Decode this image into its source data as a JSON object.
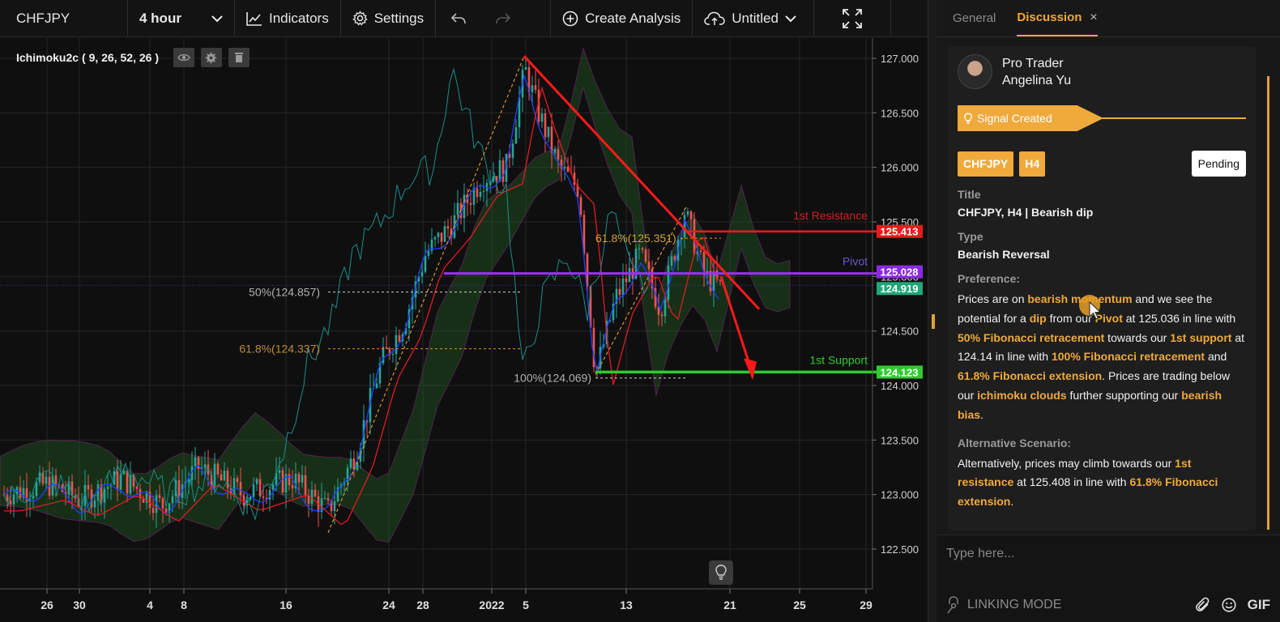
{
  "toolbar": {
    "symbol": "CHFJPY",
    "interval": "4 hour",
    "indicators_label": "Indicators",
    "settings_label": "Settings",
    "create_analysis_label": "Create Analysis",
    "layout_name": "Untitled"
  },
  "indicator": {
    "name": "Ichimoku2c",
    "params": "( 9, 26, 52, 26 )"
  },
  "chart_data": {
    "type": "candlestick",
    "symbol": "CHFJPY",
    "timeframe": "4 hour",
    "ylim": [
      122.3,
      127.1
    ],
    "y_ticks": [
      "127.000",
      "126.500",
      "126.000",
      "125.500",
      "125.000",
      "124.500",
      "124.000",
      "123.500",
      "123.000",
      "122.500"
    ],
    "x_ticks": [
      "26",
      "30",
      "4",
      "8",
      "16",
      "24",
      "28",
      "2022",
      "5",
      "13",
      "21",
      "25",
      "29"
    ],
    "price_labels": [
      {
        "text": "125.413",
        "value": 125.413,
        "color": "#e81b1b"
      },
      {
        "text": "125.028",
        "value": 125.028,
        "color": "#8a2be2"
      },
      {
        "text": "124.919",
        "value": 124.919,
        "color": "#1fa878"
      },
      {
        "text": "124.123",
        "value": 124.123,
        "color": "#2ecc2e"
      }
    ],
    "levels": [
      {
        "name": "1st Resistance",
        "value": 125.413,
        "color": "#e81b1b"
      },
      {
        "name": "Pivot",
        "value": 125.028,
        "color": "#9b30ff"
      },
      {
        "name": "1st Support",
        "value": 124.123,
        "color": "#2ecc2e"
      }
    ],
    "fib_labels": [
      {
        "text": "50%(124.857)",
        "value": 124.857
      },
      {
        "text": "61.8%(124.337)",
        "value": 124.337
      },
      {
        "text": "100%(124.069)",
        "value": 124.069
      },
      {
        "text": "61.8%(125.351)",
        "value": 125.351
      }
    ],
    "grid": true,
    "legend": "top-left"
  },
  "panel": {
    "tab_general": "General",
    "tab_discussion": "Discussion",
    "close_symbol": "×",
    "author_role": "Pro Trader",
    "author_name": "Angelina Yu",
    "signal_label": "Signal Created",
    "tags": [
      "CHFJPY",
      "H4"
    ],
    "status": "Pending",
    "title_label": "Title",
    "title_value": "CHFJPY, H4 | Bearish dip",
    "type_label": "Type",
    "type_value": "Bearish Reversal",
    "preference_label": "Preference:",
    "preference_text": [
      {
        "t": "Prices are on ",
        "h": false
      },
      {
        "t": "bearish momentum",
        "h": true
      },
      {
        "t": " and we see the potential for a ",
        "h": false
      },
      {
        "t": "dip",
        "h": true
      },
      {
        "t": " from our ",
        "h": false
      },
      {
        "t": "Pivot",
        "h": true
      },
      {
        "t": " at 125.036 in line with ",
        "h": false
      },
      {
        "t": "50% Fibonacci retracement",
        "h": true
      },
      {
        "t": " towards our ",
        "h": false
      },
      {
        "t": "1st support",
        "h": true
      },
      {
        "t": " at 124.14 in line with ",
        "h": false
      },
      {
        "t": "100% Fibonacci retracement",
        "h": true
      },
      {
        "t": " and ",
        "h": false
      },
      {
        "t": "61.8% Fibonacci extension",
        "h": true
      },
      {
        "t": ". Prices are trading below our ",
        "h": false
      },
      {
        "t": "ichimoku clouds",
        "h": true
      },
      {
        "t": " further supporting our ",
        "h": false
      },
      {
        "t": "bearish bias",
        "h": true
      },
      {
        "t": ".",
        "h": false
      }
    ],
    "alternative_label": "Alternative Scenario:",
    "alternative_text": [
      {
        "t": "Alternatively, prices may climb towards our ",
        "h": false
      },
      {
        "t": "1st resistance",
        "h": true
      },
      {
        "t": " at 125.408 in line with ",
        "h": false
      },
      {
        "t": "61.8% Fibonacci extension",
        "h": true
      },
      {
        "t": ".",
        "h": false
      }
    ],
    "message_placeholder": "Type here...",
    "linking_mode": "LINKING MODE",
    "gif_label": "GIF"
  }
}
